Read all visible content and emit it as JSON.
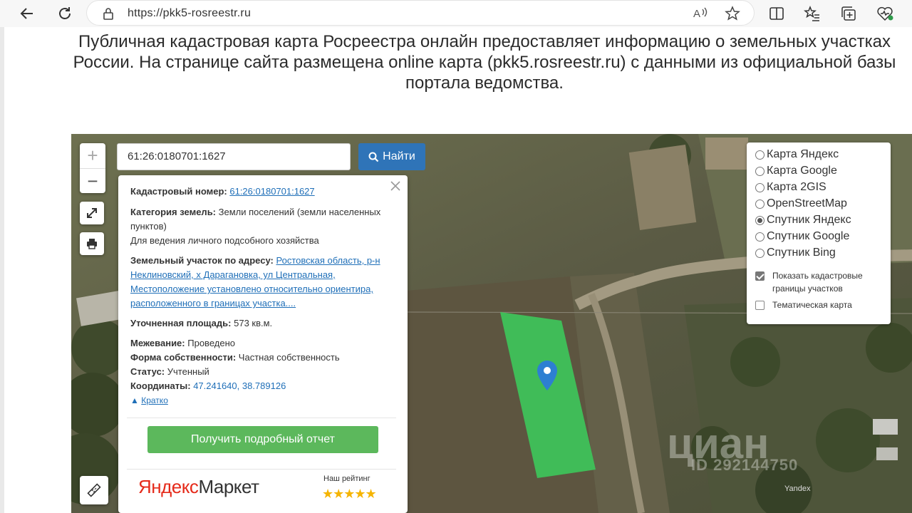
{
  "browser": {
    "url": "https://pkk5-rosreestr.ru"
  },
  "intro": {
    "text": "Публичная кадастровая карта Росреестра онлайн предоставляет информацию о земельных участках России. На странице сайта размещена online карта (pkk5.rosreestr.ru) с данными из официальной базы портала ведомства."
  },
  "map": {
    "search_value": "61:26:0180701:1627",
    "find_label": "Найти",
    "zoom_in": "+",
    "zoom_out": "−",
    "watermark": "циан",
    "watermark_id": "ID 292144750",
    "provider": "Yandex",
    "parcel_color": "#3ec25a"
  },
  "popup": {
    "cadastral_label": "Кадастровый номер:",
    "cadastral_value": "61:26:0180701:1627",
    "category_label": "Категория земель:",
    "category_value": "Земли поселений (земли населенных пунктов)",
    "purpose": "Для ведения личного подсобного хозяйства",
    "address_label": "Земельный участок по адресу:",
    "address_value": "Ростовская область, р-н Неклиновский, х Дарагановка, ул Центральная, Местоположение установлено относительно ориентира, расположенного в границах участка....",
    "area_label": "Уточненная площадь:",
    "area_value": "573 кв.м.",
    "survey_label": "Межевание:",
    "survey_value": "Проведено",
    "ownership_label": "Форма собственности:",
    "ownership_value": "Частная собственность",
    "status_label": "Статус:",
    "status_value": "Учтенный",
    "coords_label": "Координаты:",
    "coords_value": "47.241640, 38.789126",
    "brief_label": "Кратко",
    "report_button": "Получить подробный отчет",
    "market_yandex": "Яндекс",
    "market_market": "Маркет",
    "rating_label": "Наш рейтинг",
    "rating_stars": "★★★★★"
  },
  "layers": {
    "options": [
      {
        "label": "Карта Яндекс",
        "selected": false
      },
      {
        "label": "Карта Google",
        "selected": false
      },
      {
        "label": "Карта 2GIS",
        "selected": false
      },
      {
        "label": "OpenStreetMap",
        "selected": false
      },
      {
        "label": "Спутник Яндекс",
        "selected": true
      },
      {
        "label": "Спутник Google",
        "selected": false
      },
      {
        "label": "Спутник Bing",
        "selected": false
      }
    ],
    "show_borders": "Показать кадастровые границы участков",
    "thematic": "Тематическая карта"
  }
}
